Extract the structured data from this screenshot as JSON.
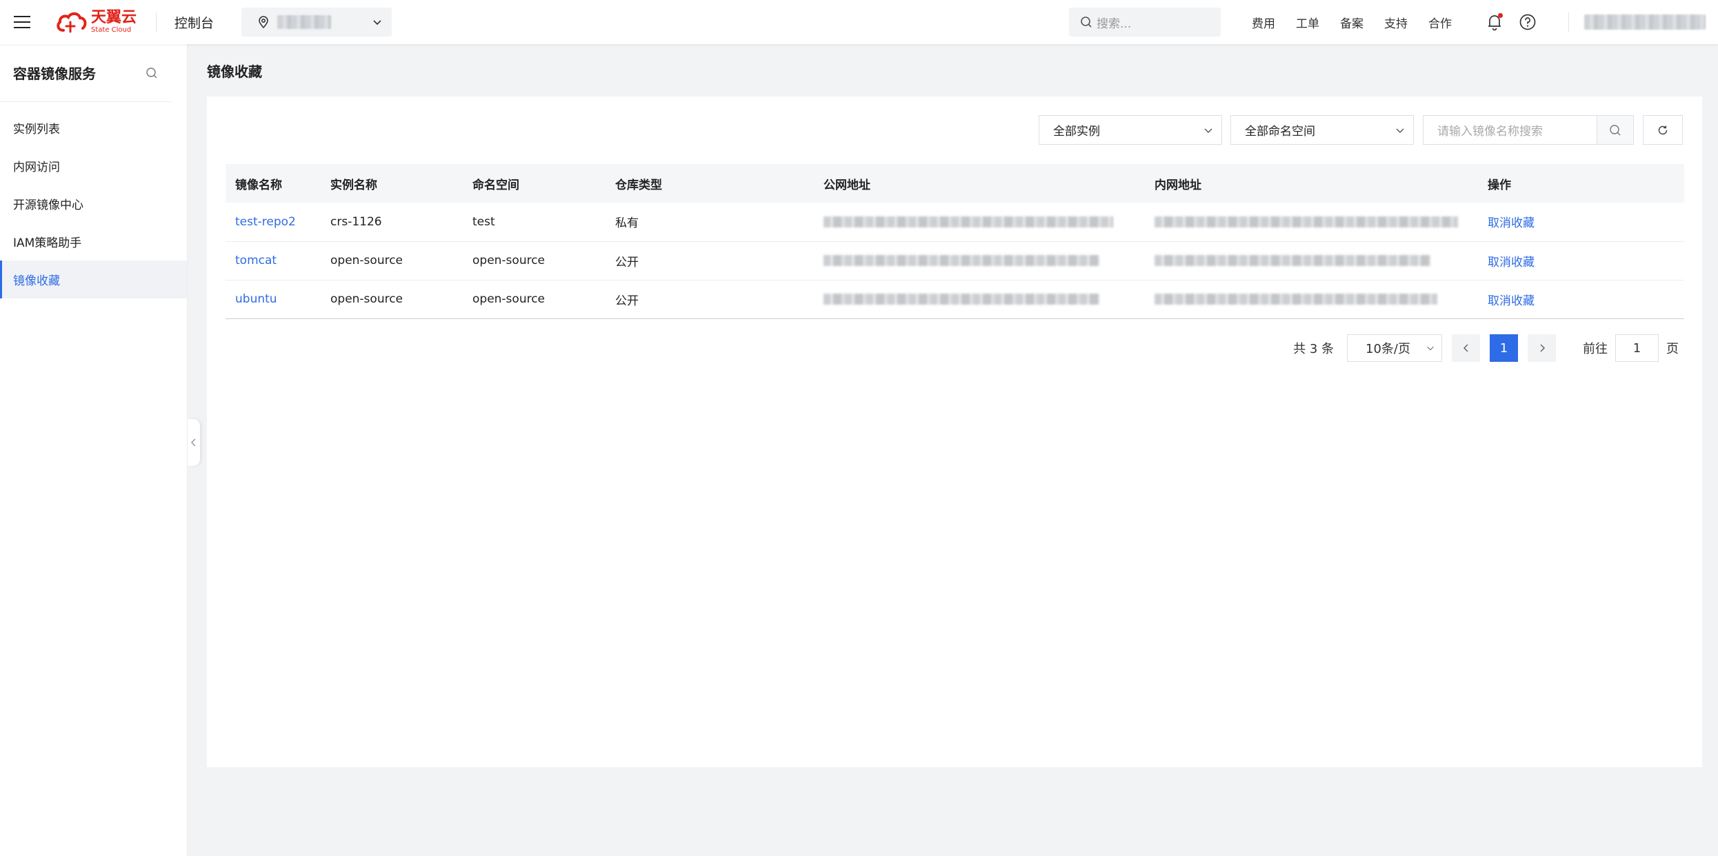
{
  "header": {
    "brand_cn": "天翼云",
    "brand_en": "State Cloud",
    "console_label": "控制台",
    "search_placeholder": "搜索...",
    "links": [
      "费用",
      "工单",
      "备案",
      "支持",
      "合作"
    ],
    "icons": {
      "menu": "hamburger-menu-icon",
      "region": "map-pin-icon",
      "bell": "bell-icon",
      "help": "question-circle-icon"
    },
    "accent_color": "#e2231a"
  },
  "sidebar": {
    "title": "容器镜像服务",
    "items": [
      {
        "label": "实例列表",
        "active": false
      },
      {
        "label": "内网访问",
        "active": false
      },
      {
        "label": "开源镜像中心",
        "active": false
      },
      {
        "label": "IAM策略助手",
        "active": false
      },
      {
        "label": "镜像收藏",
        "active": true
      }
    ],
    "active_color": "#2e6be6"
  },
  "page": {
    "title": "镜像收藏"
  },
  "filters": {
    "instance_select": "全部实例",
    "namespace_select": "全部命名空间",
    "search_placeholder": "请输入镜像名称搜索"
  },
  "table": {
    "columns": [
      "镜像名称",
      "实例名称",
      "命名空间",
      "仓库类型",
      "公网地址",
      "内网地址",
      "操作"
    ],
    "rows": [
      {
        "image": "test-repo2",
        "instance": "crs-1126",
        "namespace": "test",
        "type": "私有",
        "action": "取消收藏"
      },
      {
        "image": "tomcat",
        "instance": "open-source",
        "namespace": "open-source",
        "type": "公开",
        "action": "取消收藏"
      },
      {
        "image": "ubuntu",
        "instance": "open-source",
        "namespace": "open-source",
        "type": "公开",
        "action": "取消收藏"
      }
    ]
  },
  "pagination": {
    "total_text": "共 3 条",
    "page_size": "10条/页",
    "current_page": "1",
    "goto_label": "前往",
    "goto_value": "1",
    "page_suffix": "页"
  }
}
